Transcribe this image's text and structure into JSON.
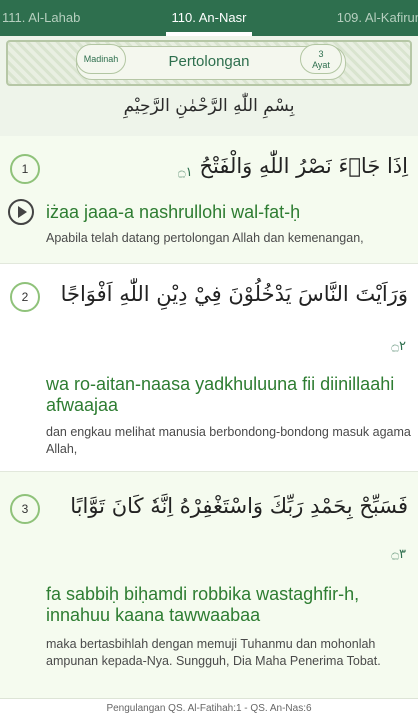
{
  "tabs": {
    "prev": "111. Al-Lahab",
    "current": "110. An-Nasr",
    "next": "109. Al-Kafirun"
  },
  "header": {
    "revelation": "Madinah",
    "title": "Pertolongan",
    "ayat_count": "3",
    "ayat_label": "Ayat",
    "basmala": "بِسْمِ اللّٰهِ الرَّحْمٰنِ الرَّحِيْمِ"
  },
  "verses": [
    {
      "number": "1",
      "arabic": "اِذَا جَاۤءَ نَصْرُ اللّٰهِ وَالْفَتْحُ",
      "mark": "۝١",
      "latin": "iżaa jaaa-a nashrullohi wal-fat-ḥ",
      "translation": "Apabila telah datang pertolongan Allah dan kemenangan,"
    },
    {
      "number": "2",
      "arabic": "وَرَاَيْتَ النَّاسَ يَدْخُلُوْنَ فِيْ دِيْنِ اللّٰهِ اَفْوَاجًا",
      "mark": "۝٢",
      "latin": "wa ro-aitan-naasa yadkhuluuna fii diinillaahi afwaajaa",
      "translation": "dan engkau melihat manusia berbondong-bondong masuk agama Allah,"
    },
    {
      "number": "3",
      "arabic": "فَسَبِّحْ بِحَمْدِ رَبِّكَ وَاسْتَغْفِرْهُ اِنَّهٗ كَانَ تَوَّابًا",
      "mark": "۝٣",
      "latin": "fa sabbiḥ biḥamdi robbika wastaghfir-h, innahuu kaana tawwaabaa",
      "translation": "maka bertasbihlah dengan memuji Tuhanmu dan mohonlah ampunan kepada-Nya. Sungguh, Dia Maha Penerima Tobat."
    }
  ],
  "footer": {
    "text": "Pengulangan QS. Al-Fatihah:1 - QS. An-Nas:6"
  },
  "colors": {
    "primary": "#2e6f4e",
    "latin_text": "#2e7d32",
    "alt_row": "#f5fbef"
  },
  "icons": {
    "play": "play-icon",
    "verse_number": "verse-number-circle"
  }
}
